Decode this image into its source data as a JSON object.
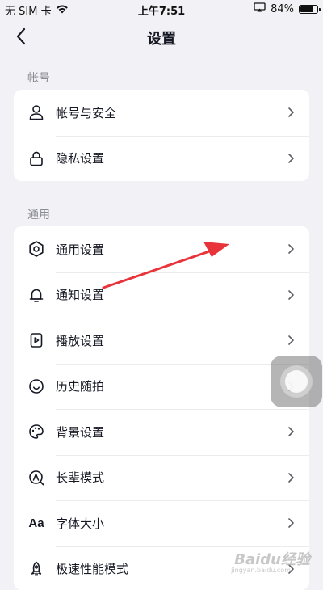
{
  "status_bar": {
    "carrier": "无 SIM 卡",
    "time": "上午7:51",
    "battery": "84%",
    "battery_level": 0.84
  },
  "nav": {
    "title": "设置"
  },
  "sections": [
    {
      "label": "帐号",
      "items": [
        {
          "label": "帐号与安全",
          "icon": "person-icon"
        },
        {
          "label": "隐私设置",
          "icon": "lock-icon"
        }
      ]
    },
    {
      "label": "通用",
      "items": [
        {
          "label": "通用设置",
          "icon": "gear-icon"
        },
        {
          "label": "通知设置",
          "icon": "bell-icon"
        },
        {
          "label": "播放设置",
          "icon": "play-icon"
        },
        {
          "label": "历史随拍",
          "icon": "history-icon"
        },
        {
          "label": "背景设置",
          "icon": "palette-icon"
        },
        {
          "label": "长辈模式",
          "icon": "elder-mode-icon"
        },
        {
          "label": "字体大小",
          "icon": "font-size-icon",
          "glyph": "Aa"
        },
        {
          "label": "极速性能模式",
          "icon": "rocket-icon"
        }
      ]
    }
  ],
  "watermark": {
    "text": "Baidu经验",
    "sub": "jingyan.baidu.com"
  },
  "colors": {
    "background": "#f2f2f6",
    "card": "#ffffff",
    "annotation_arrow": "#e8333a"
  }
}
